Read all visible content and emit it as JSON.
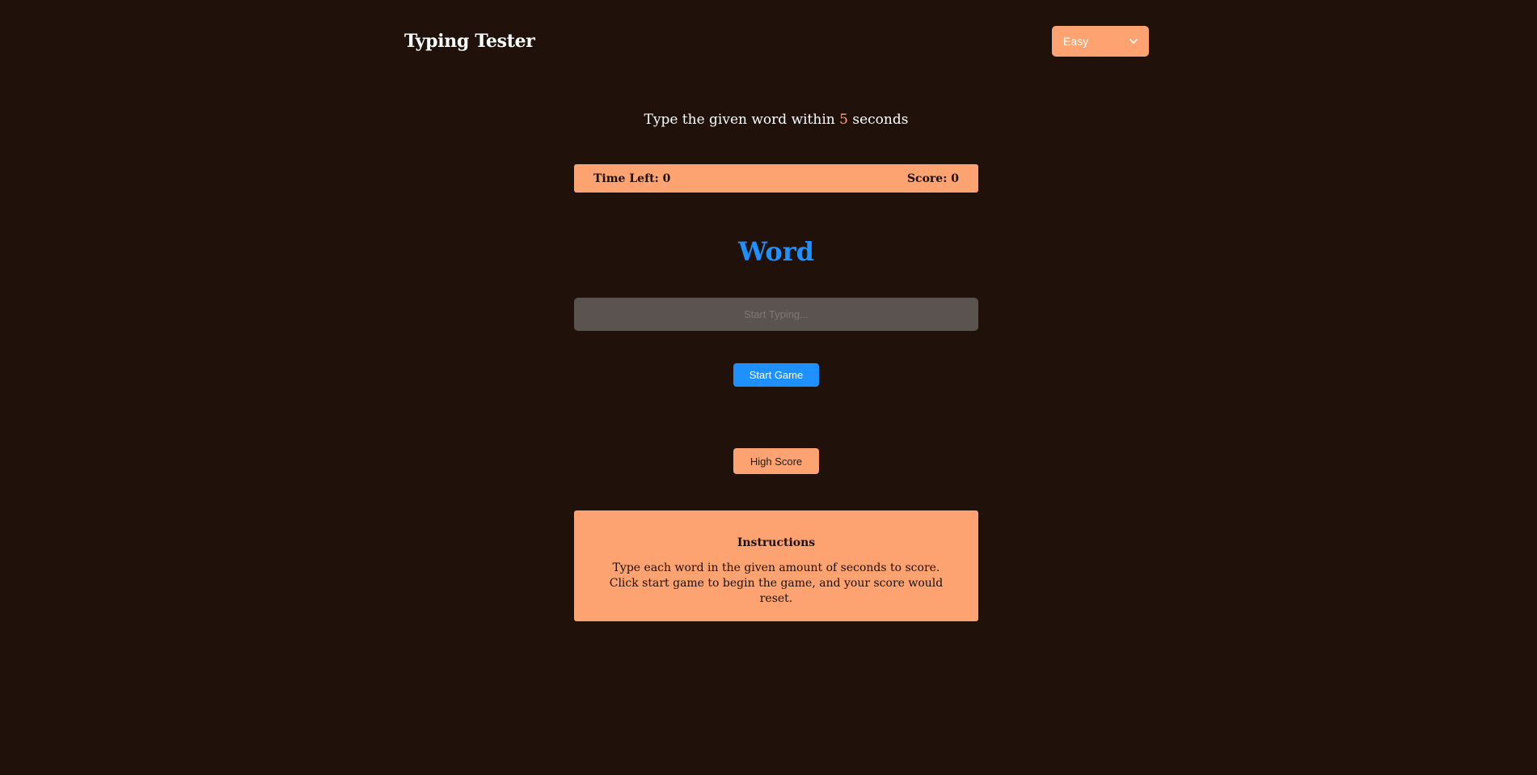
{
  "header": {
    "title": "Typing Tester",
    "difficulty": {
      "selected": "Easy",
      "icon": "chevron-down-icon"
    }
  },
  "prompt": {
    "before": "Type the given word within",
    "seconds": "5",
    "after": "seconds"
  },
  "status": {
    "time_label": "Time Left:",
    "time_value": "0",
    "score_label": "Score:",
    "score_value": "0"
  },
  "word": "Word",
  "input": {
    "placeholder": "Start Typing...",
    "value": ""
  },
  "buttons": {
    "start": "Start Game",
    "high_score": "High Score"
  },
  "instructions": {
    "title": "Instructions",
    "text": "Type each word in the given amount of seconds to score. Click start game to begin the game, and your score would reset."
  },
  "colors": {
    "background": "#20120b",
    "accent": "#fca371",
    "word": "#1e90ff",
    "input_bg": "#5a534f"
  }
}
